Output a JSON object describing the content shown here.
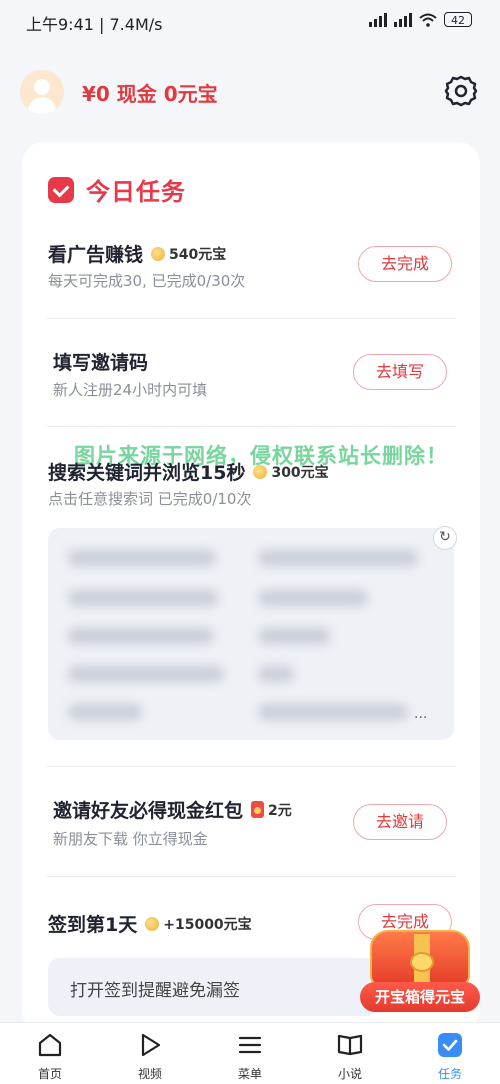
{
  "status_bar": {
    "time": "上午9:41 | 7.4M/s",
    "battery": "42",
    "icons": [
      "signal-icon",
      "hd-signal-icon",
      "wifi-icon",
      "battery-icon"
    ]
  },
  "header": {
    "balance": "¥0 现金   0元宝",
    "icons": [
      "avatar-icon",
      "gear-icon"
    ]
  },
  "card": {
    "title": "今日任务",
    "tasks": [
      {
        "name": "看广告赚钱",
        "reward": "540元宝",
        "desc": "每天可完成30, 已完成0/30次",
        "button": "去完成"
      },
      {
        "name": "填写邀请码",
        "desc": "新人注册24小时内可填",
        "button": "去填写"
      },
      {
        "name": "搜索关键词并浏览15秒",
        "reward": "300元宝",
        "desc": "点击任意搜索词 已完成0/10次"
      },
      {
        "name": "邀请好友必得现金红包",
        "reward": "2元",
        "desc": "新朋友下载 你立得现金",
        "button": "去邀请"
      },
      {
        "name": "签到第1天",
        "reward": "+15000元宝",
        "button": "去完成"
      }
    ],
    "sign_reminder": "打开签到提醒避免漏签",
    "ellipsis": "..."
  },
  "watermark": "图片来源于网络，侵权联系站长删除！",
  "treasure": {
    "label": "开宝箱得元宝"
  },
  "tabbar": {
    "tabs": [
      {
        "label": "首页",
        "icon": "home-icon"
      },
      {
        "label": "视频",
        "icon": "play-icon"
      },
      {
        "label": "菜单",
        "icon": "menu-icon"
      },
      {
        "label": "小说",
        "icon": "book-icon"
      },
      {
        "label": "任务",
        "icon": "task-check-icon",
        "active": true
      }
    ]
  },
  "colors": {
    "accent_red": "#e0393e",
    "tab_active": "#3a8df5",
    "watermark": "#5fd08a"
  }
}
